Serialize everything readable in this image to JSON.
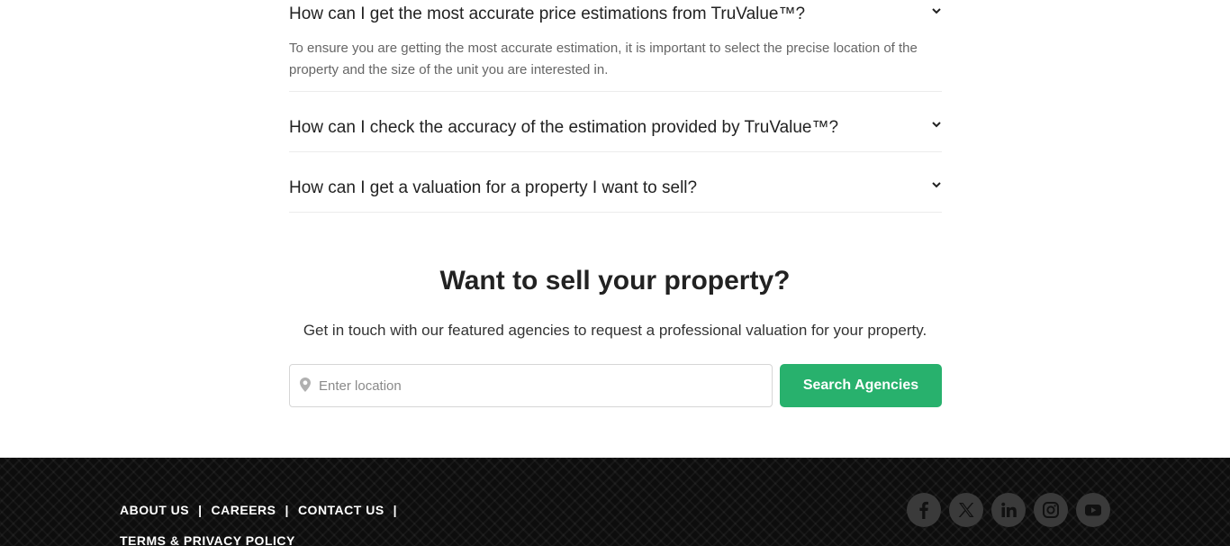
{
  "faq": {
    "items": [
      {
        "question": "How can I get the most accurate price estimations from TruValue™?",
        "answer": "To ensure you are getting the most accurate estimation, it is important to select the precise location of the property and the size of the unit you are interested in.",
        "expanded": true
      },
      {
        "question": "How can I check the accuracy of the estimation provided by TruValue™?",
        "expanded": false
      },
      {
        "question": "How can I get a valuation for a property I want to sell?",
        "expanded": false
      }
    ],
    "chevron_icon": "chevron-down-icon"
  },
  "sell": {
    "title": "Want to sell your property?",
    "subtitle": "Get in touch with our featured agencies to request a professional valuation for your property.",
    "location_placeholder": "Enter location",
    "location_value": "",
    "location_icon": "map-pin-icon",
    "search_button_label": "Search Agencies"
  },
  "footer": {
    "links": [
      {
        "label": "ABOUT US"
      },
      {
        "label": "CAREERS"
      },
      {
        "label": "CONTACT US"
      },
      {
        "label": "TERMS & PRIVACY POLICY"
      }
    ],
    "separator": "|",
    "social": [
      {
        "icon": "facebook-icon"
      },
      {
        "icon": "x-twitter-icon"
      },
      {
        "icon": "linkedin-icon"
      },
      {
        "icon": "instagram-icon"
      },
      {
        "icon": "youtube-icon"
      }
    ]
  },
  "colors": {
    "accent_green": "#28b16d",
    "footer_bg": "#0d0d0d",
    "social_circle": "#3a3a3a",
    "social_glyph": "#111111"
  }
}
